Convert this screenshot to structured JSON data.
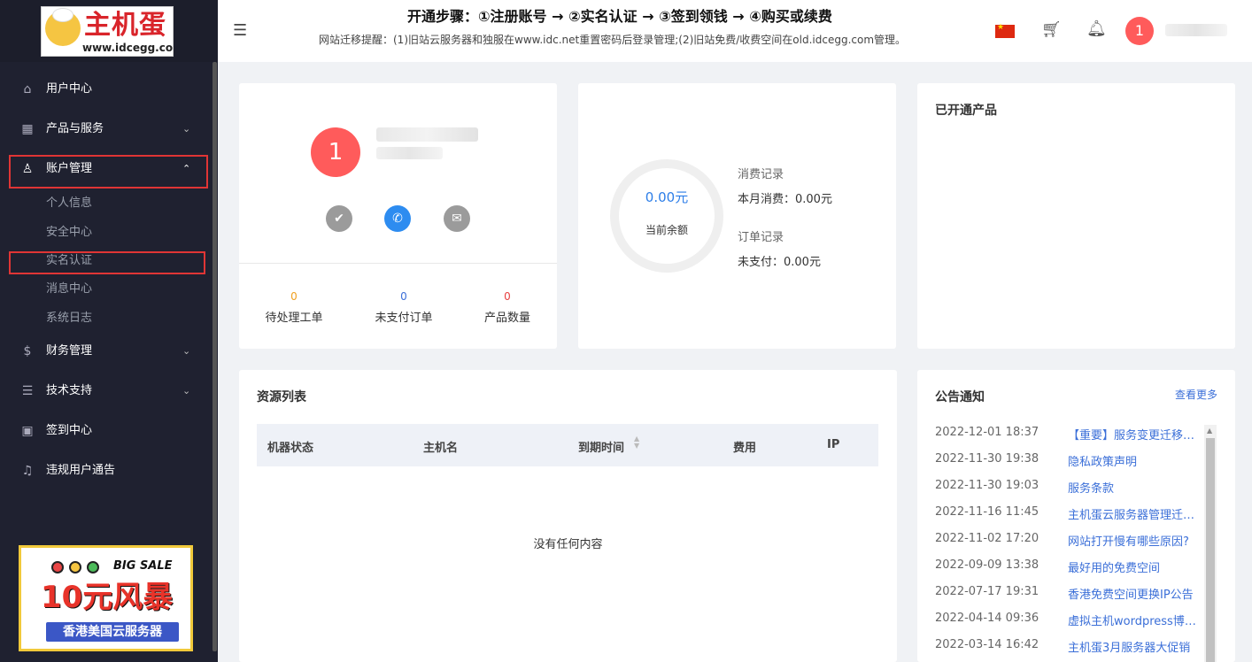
{
  "sidebar": {
    "logo": {
      "brand": "主机蛋",
      "url": "www.idcegg.com"
    },
    "nav": [
      {
        "label": "用户中心"
      },
      {
        "label": "产品与服务"
      },
      {
        "label": "账户管理"
      },
      {
        "label": "财务管理"
      },
      {
        "label": "技术支持"
      },
      {
        "label": "签到中心"
      },
      {
        "label": "违规用户通告"
      }
    ],
    "account_sub": [
      "个人信息",
      "安全中心",
      "实名认证",
      "消息中心",
      "系统日志"
    ],
    "ad": {
      "tag": "BIG SALE",
      "headline": "10元风暴",
      "subline": "香港美国云服务器"
    }
  },
  "header": {
    "steps": "开通步骤：①注册账号 → ②实名认证 → ③签到领钱 → ④购买或续费",
    "notice": "网站迁移提醒：(1)旧站云服务器和独服在www.idc.net重置密码后登录管理;(2)旧站免费/收费空间在old.idcegg.com管理。",
    "avatar": "1"
  },
  "profile": {
    "avatar": "1",
    "stats": [
      {
        "value": "0",
        "label": "待处理工单",
        "color": "#f0a020"
      },
      {
        "value": "0",
        "label": "未支付订单",
        "color": "#3b6fd8"
      },
      {
        "value": "0",
        "label": "产品数量",
        "color": "#e84040"
      }
    ]
  },
  "balance": {
    "amount": "0.00元",
    "label": "当前余额",
    "consume_title": "消费记录",
    "consume_value": "本月消费：0.00元",
    "order_title": "订单记录",
    "order_value": "未支付：0.00元"
  },
  "products": {
    "title": "已开通产品"
  },
  "resources": {
    "title": "资源列表",
    "columns": [
      "机器状态",
      "主机名",
      "到期时间",
      "费用",
      "IP"
    ],
    "empty": "没有任何内容"
  },
  "notices": {
    "title": "公告通知",
    "more": "查看更多",
    "items": [
      {
        "date": "2022-12-01 18:37",
        "title": "【重要】服务变更迁移通知"
      },
      {
        "date": "2022-11-30 19:38",
        "title": "隐私政策声明"
      },
      {
        "date": "2022-11-30 19:03",
        "title": "服务条款"
      },
      {
        "date": "2022-11-16 11:45",
        "title": "主机蛋云服务器管理迁移说明"
      },
      {
        "date": "2022-11-02 17:20",
        "title": "网站打开慢有哪些原因?"
      },
      {
        "date": "2022-09-09 13:38",
        "title": "最好用的免费空间"
      },
      {
        "date": "2022-07-17 19:31",
        "title": "香港免费空间更换IP公告"
      },
      {
        "date": "2022-04-14 09:36",
        "title": "虚拟主机wordpress博客搭建教程"
      },
      {
        "date": "2022-03-14 16:42",
        "title": "主机蛋3月服务器大促销"
      }
    ]
  }
}
